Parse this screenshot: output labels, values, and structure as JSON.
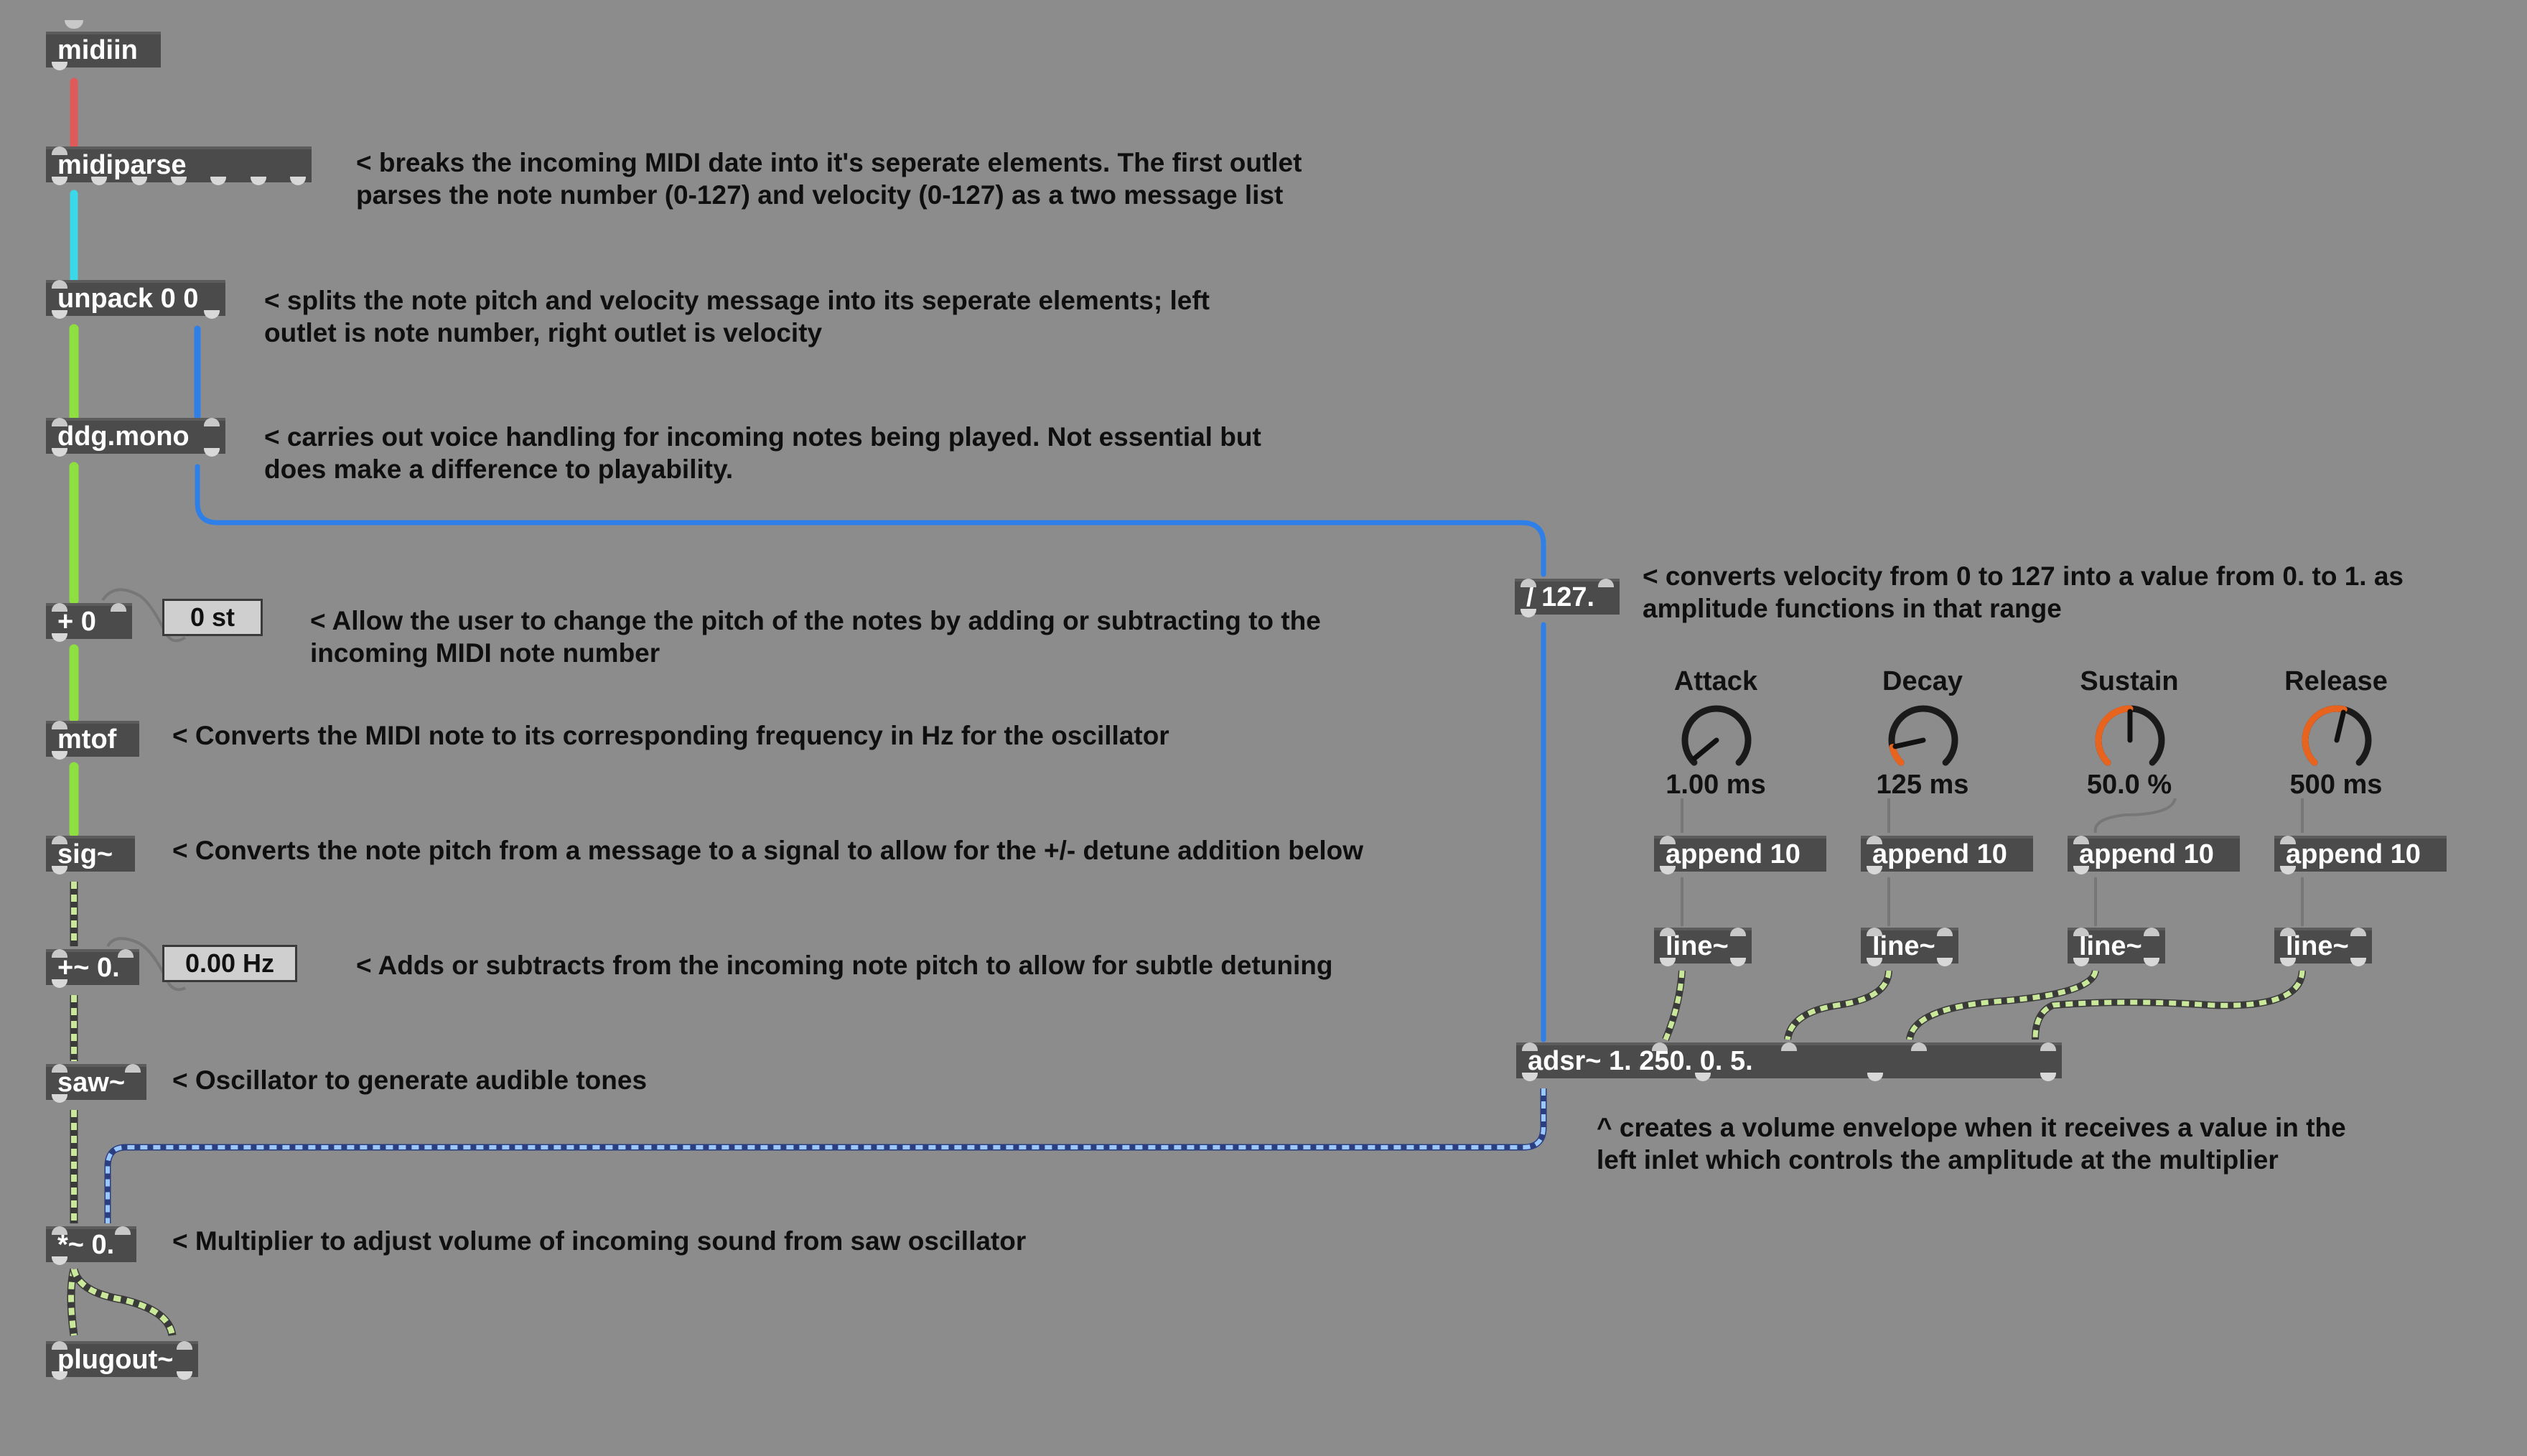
{
  "objects": {
    "midiin": "midiin",
    "midiparse": "midiparse",
    "unpack": "unpack 0 0",
    "ddg_mono": "ddg.mono",
    "plus0": "+ 0",
    "mtof": "mtof",
    "sig": "sig~",
    "plus_sig": "+~ 0.",
    "saw": "saw~",
    "mult": "*~ 0.",
    "plugout": "plugout~",
    "div127": "/ 127.",
    "adsr": "adsr~ 1. 250. 0. 5.",
    "append_attack": "append 10",
    "append_decay": "append 10",
    "append_sustain": "append 10",
    "append_release": "append 10",
    "line_attack": "line~",
    "line_decay": "line~",
    "line_sustain": "line~",
    "line_release": "line~"
  },
  "number_boxes": {
    "pitch_offset": "0 st",
    "detune": "0.00 Hz"
  },
  "comments": {
    "midiparse_1": "< breaks the incoming MIDI date into it's seperate elements. The first outlet",
    "midiparse_2": "parses the note number (0-127) and velocity (0-127) as a two message list",
    "unpack_1": "< splits the note pitch and velocity message into its seperate elements; left",
    "unpack_2": "outlet is note number, right outlet is velocity",
    "ddg_1": "< carries out voice handling for incoming notes being played. Not essential but",
    "ddg_2": "does make a difference to playability.",
    "div_1": "< converts velocity from 0 to 127 into a value from 0. to 1. as",
    "div_2": "amplitude functions in that range",
    "plus0_1": "< Allow the user to change the pitch of the notes by adding or subtracting to the",
    "plus0_2": "incoming MIDI note number",
    "mtof": "< Converts the MIDI note to its corresponding frequency in Hz for the oscillator",
    "sig": "< Converts the note pitch from a message to a signal to allow for the +/- detune addition below",
    "plus_sig": "< Adds or subtracts from the incoming note pitch to allow for subtle detuning",
    "saw": "< Oscillator to generate audible tones",
    "mult": "< Multiplier to adjust volume of incoming sound from saw oscillator",
    "adsr_1": "^ creates a volume envelope when it receives a value in the",
    "adsr_2": "left inlet which controls the amplitude at the multiplier"
  },
  "dials": {
    "attack": {
      "label": "Attack",
      "value": "1.00 ms",
      "level": 0.02
    },
    "decay": {
      "label": "Decay",
      "value": "125 ms",
      "level": 0.12
    },
    "sustain": {
      "label": "Sustain",
      "value": "50.0 %",
      "level": 0.5
    },
    "release": {
      "label": "Release",
      "value": "500 ms",
      "level": 0.55
    }
  },
  "colors": {
    "background": "#8c8c8c",
    "object_bg": "#4b4b4b",
    "cord_midi_red": "#e05a5a",
    "cord_midi_cyan": "#3ad8e8",
    "cord_green": "#8ee040",
    "cord_blue": "#2f7fe8",
    "cord_signal": "#c9e89a",
    "dial_accent": "#e8641e"
  }
}
